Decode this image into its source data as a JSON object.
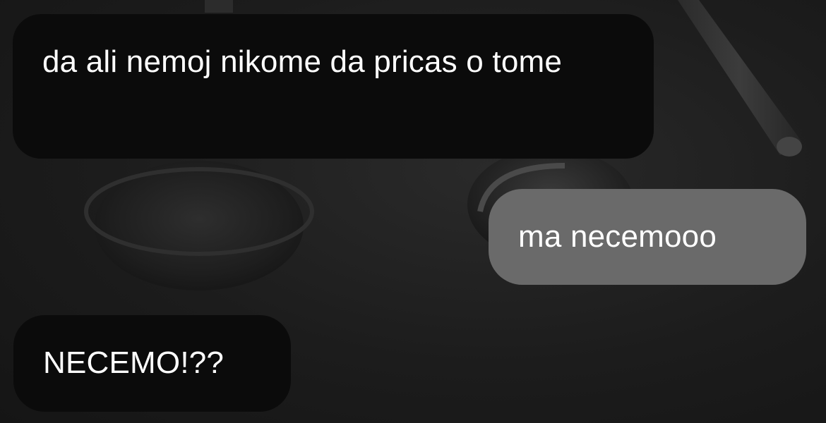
{
  "conversation": {
    "messages": [
      {
        "text": "da ali nemoj nikome da pricas o tome",
        "direction": "received"
      },
      {
        "text": "ma necemooo",
        "direction": "sent"
      },
      {
        "text": "NECEMO!??",
        "direction": "received"
      }
    ]
  },
  "colors": {
    "received_bubble": "#0b0b0b",
    "sent_bubble": "#6a6a6a",
    "text": "#ffffff"
  }
}
